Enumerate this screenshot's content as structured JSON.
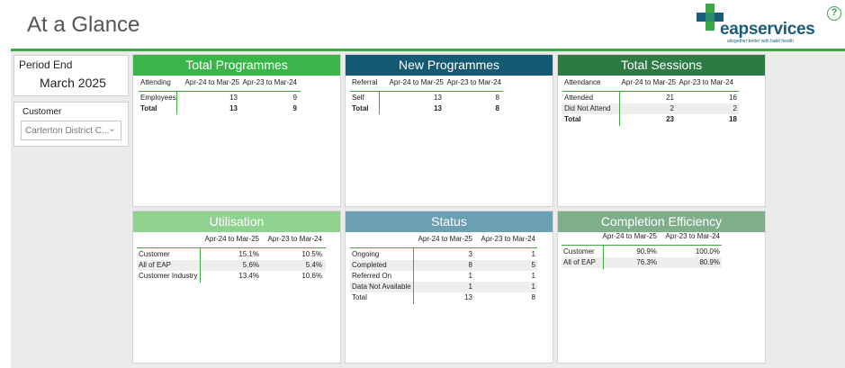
{
  "header": {
    "title": "At a Glance",
    "logo_text": "eapservices",
    "logo_tagline": "altogether better with habit health",
    "help_symbol": "?"
  },
  "colors": {
    "accent_green": "#3aa845",
    "programmes_green": "#3ab54a",
    "new_teal": "#145a72",
    "sessions_green": "#2e7a45",
    "utilisation_green": "#8fd28f",
    "status_blue": "#6b9fb2",
    "efficiency_green": "#7fae8a"
  },
  "slicers": {
    "period": {
      "label": "Period End",
      "value": "March 2025"
    },
    "customer": {
      "label": "Customer",
      "value": "Carterton District C..."
    }
  },
  "cards": {
    "total_programmes": {
      "title": "Total Programmes",
      "headers": [
        "Attending",
        "Apr-24 to Mar-25",
        "Apr-23 to Mar-24"
      ],
      "rows": [
        [
          "Employees",
          "13",
          "9"
        ]
      ],
      "total": [
        "Total",
        "13",
        "9"
      ]
    },
    "new_programmes": {
      "title": "New Programmes",
      "headers": [
        "Referral",
        "Apr-24 to Mar-25",
        "Apr-23 to Mar-24"
      ],
      "rows": [
        [
          "Self",
          "13",
          "8"
        ]
      ],
      "total": [
        "Total",
        "13",
        "8"
      ]
    },
    "total_sessions": {
      "title": "Total Sessions",
      "headers": [
        "Attendance",
        "Apr-24 to Mar-25",
        "Apr-23 to Mar-24"
      ],
      "rows": [
        [
          "Attended",
          "21",
          "16"
        ],
        [
          "Did Not Attend",
          "2",
          "2"
        ]
      ],
      "total": [
        "Total",
        "23",
        "18"
      ]
    },
    "utilisation": {
      "title": "Utilisation",
      "headers": [
        "",
        "Apr-24 to Mar-25",
        "Apr-23 to Mar-24"
      ],
      "rows": [
        [
          "Customer",
          "15.1%",
          "10.5%"
        ],
        [
          "All of EAP",
          "5.6%",
          "5.4%"
        ],
        [
          "Customer Industry",
          "13.4%",
          "10.6%"
        ]
      ]
    },
    "status": {
      "title": "Status",
      "headers": [
        "",
        "Apr-24 to Mar-25",
        "Apr-23 to Mar-24"
      ],
      "rows": [
        [
          "Ongoing",
          "3",
          "1"
        ],
        [
          "Completed",
          "8",
          "5"
        ],
        [
          "Referred On",
          "1",
          "1"
        ],
        [
          "Data Not Available",
          "1",
          "1"
        ],
        [
          "Total",
          "13",
          "8"
        ]
      ]
    },
    "completion_efficiency": {
      "title": "Completion Efficiency",
      "headers": [
        "",
        "Apr-24 to Mar-25",
        "Apr-23 to Mar-24"
      ],
      "rows": [
        [
          "Customer",
          "90.9%",
          "100.0%"
        ],
        [
          "All of EAP",
          "76.3%",
          "80.9%"
        ]
      ]
    }
  }
}
